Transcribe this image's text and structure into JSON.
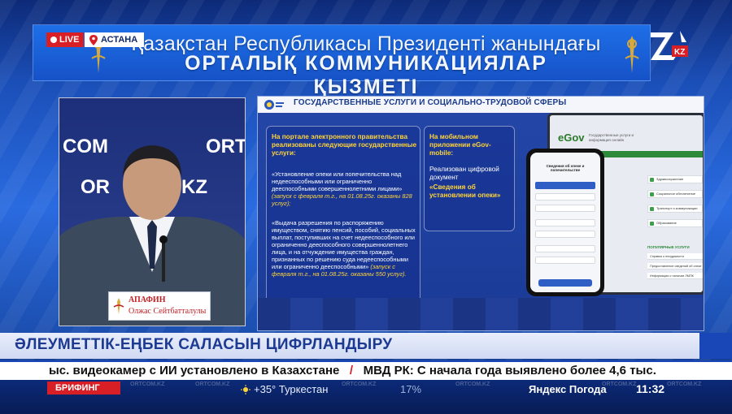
{
  "header": {
    "live_label": "LIVE",
    "location": "АСТАНА",
    "title_line1": "Қазақстан Республикасы Президенті жанындағы",
    "title_line2": "ОРТАЛЫҚ  КОММУНИКАЦИЯЛАР ҚЫЗМЕТІ",
    "channel_logo_text": "KZ"
  },
  "speaker": {
    "backdrop_words": [
      "COM",
      "ORT",
      "OR",
      "KZ"
    ],
    "surname": "АПАФИН",
    "name": "Олжас Сейтбатталулы"
  },
  "slide": {
    "title": "ГОСУДАРСТВЕННЫЕ УСЛУГИ И СОЦИАЛЬНО-ТРУДОВОЙ СФЕРЫ",
    "box1": {
      "heading": "На портале электронного правительства реализованы следующие государственные услуги:",
      "item1": "«Установление опеки или попечительства над недееспособными или ограниченно дееспособными совершеннолетними лицами»",
      "item1_note": "(запуск с февраля т.г., на 01.08.25г. оказаны 828 услуг);",
      "item2": "«Выдача разрешения по распоряжению имуществом, снятию пенсий, пособий, социальных выплат, поступивших на счет недееспособного или ограниченно дееспособного совершеннолетнего лица, и на отчуждение имущества граждан, признанных по решению суда недееспособными или ограниченно дееспособными»",
      "item2_note": "(запуск с февраля т.г., на 01.08.25г. оказаны 550 услуг)."
    },
    "box2": {
      "heading": "На мобильном приложении eGov-mobile:",
      "text": "Реализован цифровой документ",
      "accent": "«Сведения об установлении опеки»"
    },
    "laptop": {
      "logo": "eGov",
      "tagline": "Государственные услуги и информация онлайн",
      "services": [
        "Здравоохранение",
        "Социальное обеспечение",
        "Транспорт и коммуникации",
        "Образование"
      ],
      "popular_title": "ПОПУЛЯРНЫЕ УСЛУГИ",
      "popular": [
        "Справка о несудимости",
        "Предоставление сведений об опеке",
        "Информация о наличии ЛМПК"
      ]
    },
    "phone": {
      "title": "Сведения об опеке и попечительстве"
    }
  },
  "lower_third": {
    "headline": "ӘЛЕУМЕТТІК-ЕҢБЕК САЛАСЫН ЦИФРЛАНДЫРУ",
    "ticker_part1": "ыс. видеокамер с ИИ установлено в Казахстане",
    "ticker_sep": "/",
    "ticker_part2": "МВД РК: С начала года выявлено более 4,6 тыс."
  },
  "bottom_bar": {
    "tag": "БРИФИНГ",
    "watermark": "ORTCOM.KZ",
    "weather": "+35° Туркестан",
    "humidity": "17%",
    "weather_brand": "Яндекс Погода",
    "time": "11:32"
  },
  "colors": {
    "live_red": "#d81f26",
    "brand_blue": "#1a47b8",
    "slide_yellow": "#ffd43a",
    "headline_blue": "#1c3a92"
  }
}
